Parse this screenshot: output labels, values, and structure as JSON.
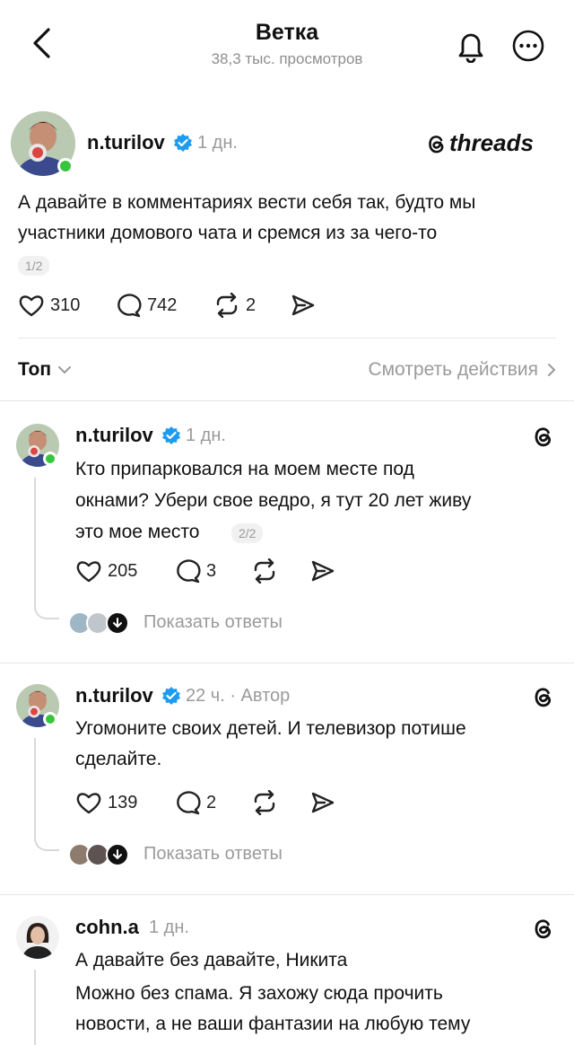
{
  "header": {
    "title": "Ветка",
    "views": "38,3 тыс. просмотров"
  },
  "main_post": {
    "username": "n.turilov",
    "time": "1 дн.",
    "brand": "threads",
    "text_line1": "А давайте в комментариях вести себя так, будто мы",
    "text_line2": "участники домового чата и сремся из за чего-то",
    "pager": "1/2",
    "likes": "310",
    "comments": "742",
    "reposts": "2"
  },
  "sort_bar": {
    "sort_label": "Топ",
    "activity_link": "Смотреть действия"
  },
  "replies": [
    {
      "username": "n.turilov",
      "time": "1 дн.",
      "text_line1": "Кто припарковался на моем месте под",
      "text_line2": "окнами? Убери свое ведро, я тут 20 лет живу",
      "text_line3": "это мое место",
      "pager": "2/2",
      "likes": "205",
      "comments": "3",
      "show_replies": "Показать ответы"
    },
    {
      "username": "n.turilov",
      "time": "22 ч. · Автор",
      "text_line1": "Угомоните своих детей. И телевизор потише",
      "text_line2": "сделайте.",
      "likes": "139",
      "comments": "2",
      "show_replies": "Показать ответы"
    },
    {
      "username": "cohn.a",
      "time": "1 дн.",
      "text_line1": "А давайте без давайте, Никита",
      "text_line2": "Можно без спама. Я захожу сюда прочить",
      "text_line3": "новости, а не ваши фантазии на любую тему"
    }
  ],
  "colors": {
    "verified": "#1d9bf0",
    "online": "#37c53d",
    "muted": "#9a9a9a"
  },
  "icons": [
    "back-arrow-icon",
    "bell-icon",
    "more-icon",
    "verified-icon",
    "threads-logo-icon",
    "heart-icon",
    "comment-icon",
    "repost-icon",
    "share-icon",
    "chevron-down-icon",
    "chevron-right-icon",
    "arrow-down-icon"
  ]
}
